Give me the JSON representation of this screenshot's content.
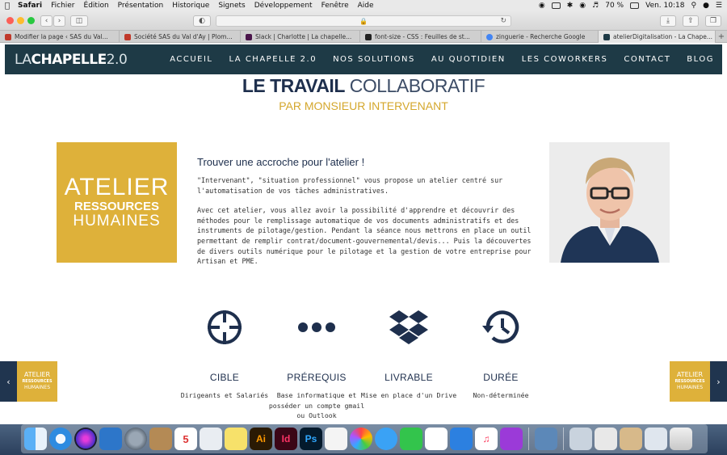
{
  "menubar": {
    "app": "Safari",
    "items": [
      "Fichier",
      "Édition",
      "Présentation",
      "Historique",
      "Signets",
      "Développement",
      "Fenêtre",
      "Aide"
    ],
    "battery": "70 %",
    "clock": "Ven. 10:18"
  },
  "tabs": [
    {
      "label": "Modifier la page ‹ SAS du Val...",
      "color": "#c0392b"
    },
    {
      "label": "Société SAS du Val d'Ay | Plom...",
      "color": "#c0392b"
    },
    {
      "label": "Slack | Charlotte | La chapelle...",
      "color": "#4a154b"
    },
    {
      "label": "font-size - CSS : Feuilles de st...",
      "color": "#222222"
    },
    {
      "label": "zinguerie - Recherche Google",
      "color": "#4285f4"
    },
    {
      "label": "atelierDigitalisation - La Chape...",
      "color": "#1e3a46"
    }
  ],
  "site": {
    "logo_thin": "LA",
    "logo_bold": "CHAPELLE",
    "logo_version": "2.0",
    "nav": [
      "ACCUEIL",
      "LA CHAPELLE 2.0",
      "NOS SOLUTIONS",
      "AU QUOTIDIEN",
      "LES COWORKERS",
      "CONTACT",
      "BLOG"
    ],
    "title_bold": "LE TRAVAIL",
    "title_light": "COLLABORATIF",
    "subtitle": "PAR MONSIEUR INTERVENANT",
    "atelier_line1": "ATELIER",
    "atelier_line2": "RESSOURCES",
    "atelier_line3": "HUMAINES",
    "hook_title": "Trouver une accroche pour l'atelier !",
    "para1": "\"Intervenant\", \"situation professionnel\" vous propose un atelier centré sur l'automatisation de vos tâches administratives.",
    "para2": "Avec cet atelier, vous allez avoir la possibilité d'apprendre et découvrir des méthodes pour le remplissage automatique de vos documents administratifs et des instruments de pilotage/gestion. Pendant la séance nous mettrons en place un outil permettant de remplir contrat/document-gouvernemental/devis... Puis la découvertes de divers outils numérique pour le pilotage et la gestion de votre entreprise pour Artisan et PME.",
    "features": [
      {
        "icon": "crosshair-icon",
        "title": "CIBLE",
        "value": "Dirigeants et Salariés"
      },
      {
        "icon": "dots-icon",
        "title": "PRÉREQUIS",
        "value": "Base informatique et posséder un compte gmail ou Outlook"
      },
      {
        "icon": "dropbox-icon",
        "title": "LIVRABLE",
        "value": "Mise en place d'un Drive"
      },
      {
        "icon": "history-icon",
        "title": "DURÉE",
        "value": "Non-déterminée"
      }
    ],
    "side_thumb": {
      "l1": "ATELIER",
      "l2": "RESSOURCES",
      "l3": "HUMAINES"
    }
  },
  "dock": {
    "calendar_day": "5",
    "ai_label": "Ai",
    "id_label": "Id",
    "ps_label": "Ps"
  }
}
